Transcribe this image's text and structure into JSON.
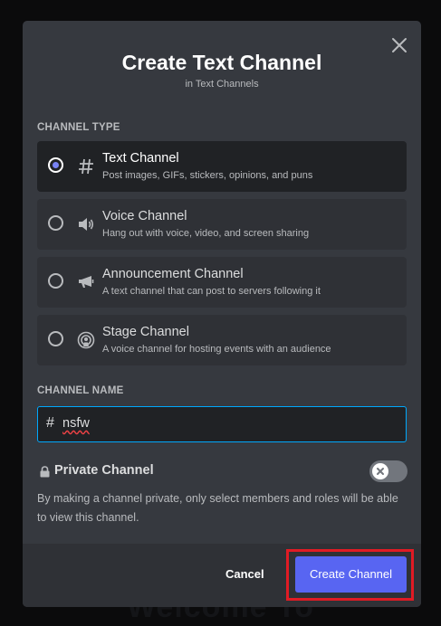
{
  "background_heading": "Welcome To",
  "modal": {
    "title": "Create Text Channel",
    "subtitle": "in Text Channels",
    "close_icon": "close-icon"
  },
  "channel_type": {
    "label": "CHANNEL TYPE",
    "selected": "Text Channel",
    "options": [
      {
        "title": "Text Channel",
        "description": "Post images, GIFs, stickers, opinions, and puns",
        "icon": "hash-icon",
        "selected": true
      },
      {
        "title": "Voice Channel",
        "description": "Hang out with voice, video, and screen sharing",
        "icon": "speaker-icon",
        "selected": false
      },
      {
        "title": "Announcement Channel",
        "description": "A text channel that can post to servers following it",
        "icon": "megaphone-icon",
        "selected": false
      },
      {
        "title": "Stage Channel",
        "description": "A voice channel for hosting events with an audience",
        "icon": "stage-icon",
        "selected": false
      }
    ]
  },
  "channel_name": {
    "label": "CHANNEL NAME",
    "prefix": "#",
    "value": "nsfw"
  },
  "private": {
    "label": "Private Channel",
    "enabled": false,
    "description": "By making a channel private, only select members and roles will be able to view this channel."
  },
  "footer": {
    "cancel_label": "Cancel",
    "create_label": "Create Channel"
  },
  "colors": {
    "modal_bg": "#36393f",
    "option_bg": "#2f3136",
    "selected_bg": "#202225",
    "accent": "#5865f2",
    "highlight_box": "#e01b24",
    "input_border": "#00a8fc"
  }
}
